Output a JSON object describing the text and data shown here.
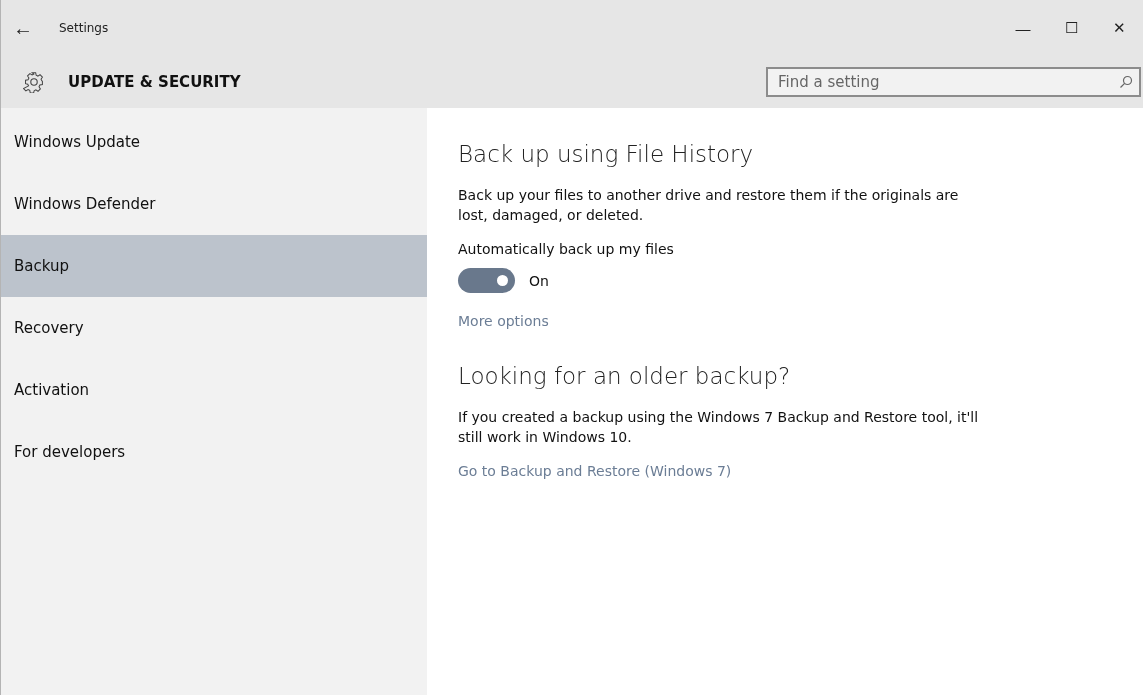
{
  "window": {
    "title": "Settings",
    "back": "←",
    "controls": {
      "minimize": "—",
      "maximize": "☐",
      "close": "✕"
    }
  },
  "header": {
    "title": "UPDATE & SECURITY",
    "search": {
      "placeholder": "Find a setting"
    }
  },
  "sidebar": {
    "items": [
      {
        "label": "Windows Update",
        "selected": false
      },
      {
        "label": "Windows Defender",
        "selected": false
      },
      {
        "label": "Backup",
        "selected": true
      },
      {
        "label": "Recovery",
        "selected": false
      },
      {
        "label": "Activation",
        "selected": false
      },
      {
        "label": "For developers",
        "selected": false
      }
    ]
  },
  "content": {
    "sections": [
      {
        "heading": "Back up using File History",
        "description": "Back up your files to another drive and restore them if the originals are lost, damaged, or deleted.",
        "toggle": {
          "label": "Automatically back up my files",
          "on": true,
          "state_text": "On"
        },
        "link": "More options"
      },
      {
        "heading": "Looking for an older backup?",
        "description": "If you created a backup using the Windows 7 Backup and Restore tool, it'll still work in Windows 10.",
        "link": "Go to Backup and Restore (Windows 7)"
      }
    ]
  }
}
